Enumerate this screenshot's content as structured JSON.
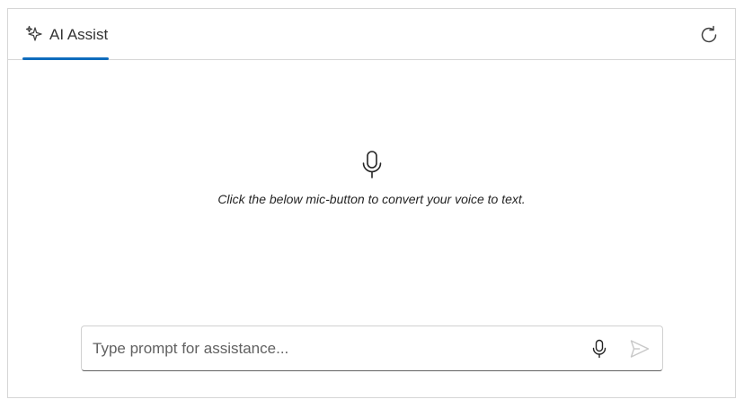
{
  "header": {
    "tab": {
      "label": "AI Assist",
      "icon": "sparkle-icon",
      "active": true,
      "indicator_color": "#0f6cbd"
    },
    "refresh_icon": "refresh-icon"
  },
  "content": {
    "empty_state": {
      "icon": "microphone-icon",
      "message": "Click the below mic-button to convert your voice to text."
    }
  },
  "prompt": {
    "placeholder": "Type prompt for assistance...",
    "value": "",
    "mic_icon": "microphone-icon",
    "send_icon": "send-icon"
  }
}
